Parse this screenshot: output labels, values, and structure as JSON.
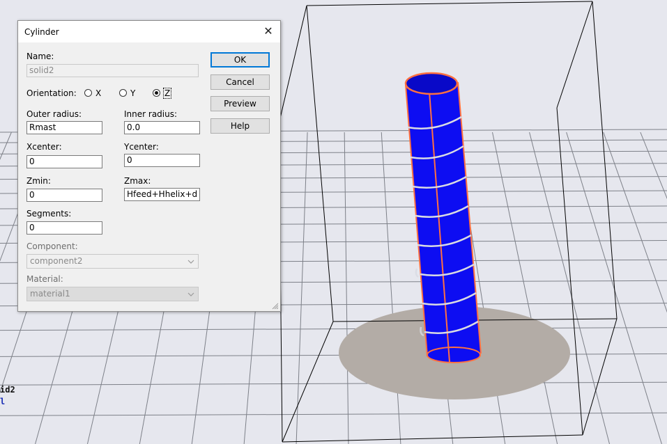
{
  "dialog": {
    "title": "Cylinder",
    "close_glyph": "✕",
    "name_label": "Name:",
    "name_value": "solid2",
    "orientation_label": "Orientation:",
    "orientation_options": [
      "X",
      "Y",
      "Z"
    ],
    "orientation_selected": "Z",
    "outer_radius_label": "Outer radius:",
    "outer_radius_value": "Rmast",
    "inner_radius_label": "Inner radius:",
    "inner_radius_value": "0.0",
    "xcenter_label": "Xcenter:",
    "xcenter_value": "0",
    "ycenter_label": "Ycenter:",
    "ycenter_value": "0",
    "zmin_label": "Zmin:",
    "zmin_value": "0",
    "zmax_label": "Zmax:",
    "zmax_value": "Hfeed+Hhelix+d",
    "segments_label": "Segments:",
    "segments_value": "0",
    "component_label": "Component:",
    "component_value": "component2",
    "material_label": "Material:",
    "material_value": "material1",
    "buttons": {
      "ok": "OK",
      "cancel": "Cancel",
      "preview": "Preview",
      "help": "Help"
    }
  },
  "viewport": {
    "side_label_lines": [
      "id2",
      "l"
    ],
    "colors": {
      "background": "#e6e7ee",
      "grid": "#7d8088",
      "cylinder": "#0d0df2",
      "cylinder_edge": "#ff7040",
      "helix": "#d9dbe3",
      "ground_plane": "#b3aca6",
      "bounding_box": "#000000"
    },
    "icons": [
      "close-icon",
      "combo-arrow-icon",
      "resize-grip-icon"
    ]
  }
}
